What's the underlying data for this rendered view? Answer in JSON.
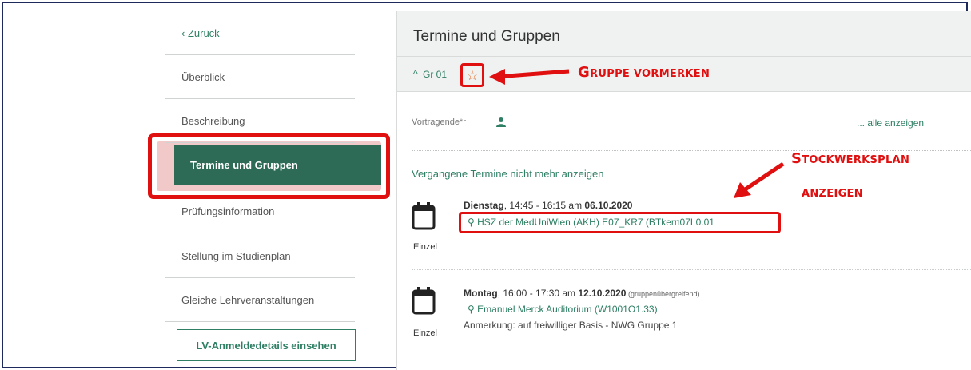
{
  "nav": {
    "back": "Zurück",
    "items": [
      "Überblick",
      "Beschreibung",
      "Termine und Gruppen",
      "Prüfungsinformation",
      "Stellung im Studienplan",
      "Gleiche Lehrveranstaltungen"
    ],
    "button": "LV-Anmeldedetails einsehen"
  },
  "panel": {
    "title": "Termine und Gruppen",
    "group_label": "Gr 01",
    "vortragende": "Vortragende*r",
    "alle": "... alle anzeigen",
    "vergangene": "Vergangene Termine nicht mehr anzeigen"
  },
  "termine": [
    {
      "day": "Dienstag",
      "time": ", 14:45 - 16:15 am ",
      "date": "06.10.2020",
      "extra": "",
      "room": "HSZ der MedUniWien (AKH) E07_KR7 (BTkern07L0.01",
      "note": "",
      "type": "Einzel"
    },
    {
      "day": "Montag",
      "time": ", 16:00 - 17:30 am ",
      "date": "12.10.2020",
      "extra": " (gruppenübergreifend)",
      "room": "Emanuel Merck Auditorium (W1001O1.33)",
      "note": "Anmerkung: auf freiwilliger Basis - NWG Gruppe 1",
      "type": "Einzel"
    }
  ],
  "annotations": {
    "gruppe_1": "G",
    "gruppe_2": "RUPPE VORMERKEN",
    "stock_1": "S",
    "stock_2": "TOCKWERKSPLAN",
    "anzeigen": "ANZEIGEN"
  },
  "colors": {
    "accent": "#2e7f63",
    "active_nav": "#2d6b57",
    "highlight": "#e01010",
    "star": "#e8732e"
  },
  "icons": [
    "chevron-left-icon",
    "chevron-up-icon",
    "star-icon",
    "person-icon",
    "calendar-icon",
    "location-pin-icon"
  ]
}
